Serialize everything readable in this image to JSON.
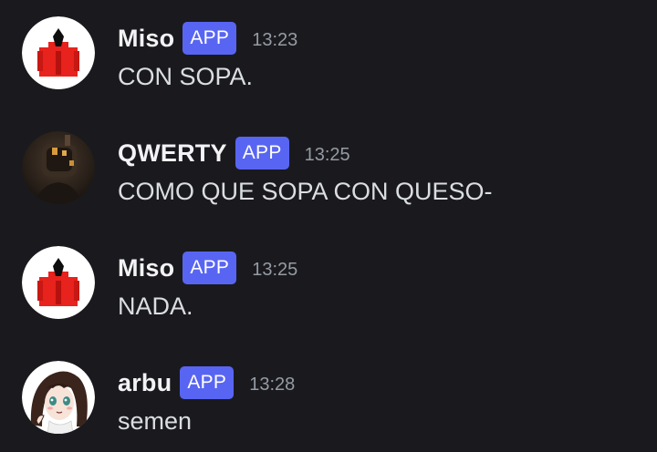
{
  "colors": {
    "background": "#1a1a1e",
    "username": "#f2f3f5",
    "message_text": "#dbdee1",
    "timestamp": "#949ba4",
    "app_badge": "#5865f2"
  },
  "messages": [
    {
      "author": "Miso",
      "badge": "APP",
      "time": "13:23",
      "text": "CON SOPA.",
      "avatar_icon": "red-figure-avatar-icon"
    },
    {
      "author": "QWERTY",
      "badge": "APP",
      "time": "13:25",
      "text": "COMO QUE SOPA CON QUESO-",
      "avatar_icon": "dark-helmet-avatar-icon"
    },
    {
      "author": "Miso",
      "badge": "APP",
      "time": "13:25",
      "text": "NADA.",
      "avatar_icon": "red-figure-avatar-icon"
    },
    {
      "author": "arbu",
      "badge": "APP",
      "time": "13:28",
      "text": "semen",
      "avatar_icon": "anime-girl-avatar-icon"
    }
  ]
}
